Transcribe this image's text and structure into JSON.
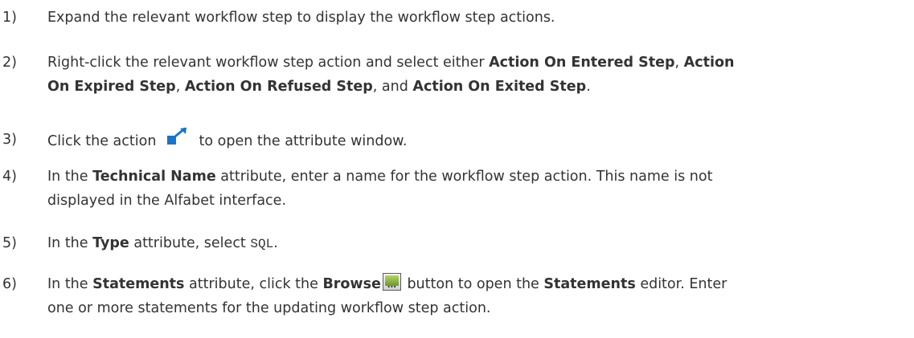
{
  "steps": [
    {
      "number": "1)",
      "text": "Expand the relevant workflow step to display the workflow step actions."
    },
    {
      "number": "2)",
      "line1_pre": "Right-click the relevant workflow step action and select either ",
      "action_entered": "Action On Entered Step",
      "sep1": ", ",
      "action_expired_part1": "Action",
      "action_expired_part2": "On Expired Step",
      "sep2": ", ",
      "action_refused": "Action On Refused Step",
      "sep3": ", and ",
      "action_exited": "Action On Exited Step",
      "end": "."
    },
    {
      "number": "3)",
      "pre": "Click the action ",
      "icon": "expand-arrow-icon",
      "post": " to open the attribute window."
    },
    {
      "number": "4)",
      "pre": "In the ",
      "bold": "Technical Name",
      "post_line1": " attribute, enter a name for the workflow step action. This name is not",
      "line2": "displayed in the Alfabet interface."
    },
    {
      "number": "5)",
      "pre": "In the ",
      "bold": "Type",
      "mid": " attribute, select ",
      "code": "SQL",
      "end": "."
    },
    {
      "number": "6)",
      "pre": "In the ",
      "bold1": "Statements",
      "mid1": " attribute, click the ",
      "bold2": "Browse",
      "icon": "browse-icon",
      "icon_dots": "...",
      "mid2": " button to open the ",
      "bold3": "Statements",
      "post_line1": " editor. Enter",
      "line2": "one or more statements for the updating workflow step action."
    }
  ],
  "colors": {
    "text": "#333333",
    "icon_blue": "#1a74c8"
  }
}
